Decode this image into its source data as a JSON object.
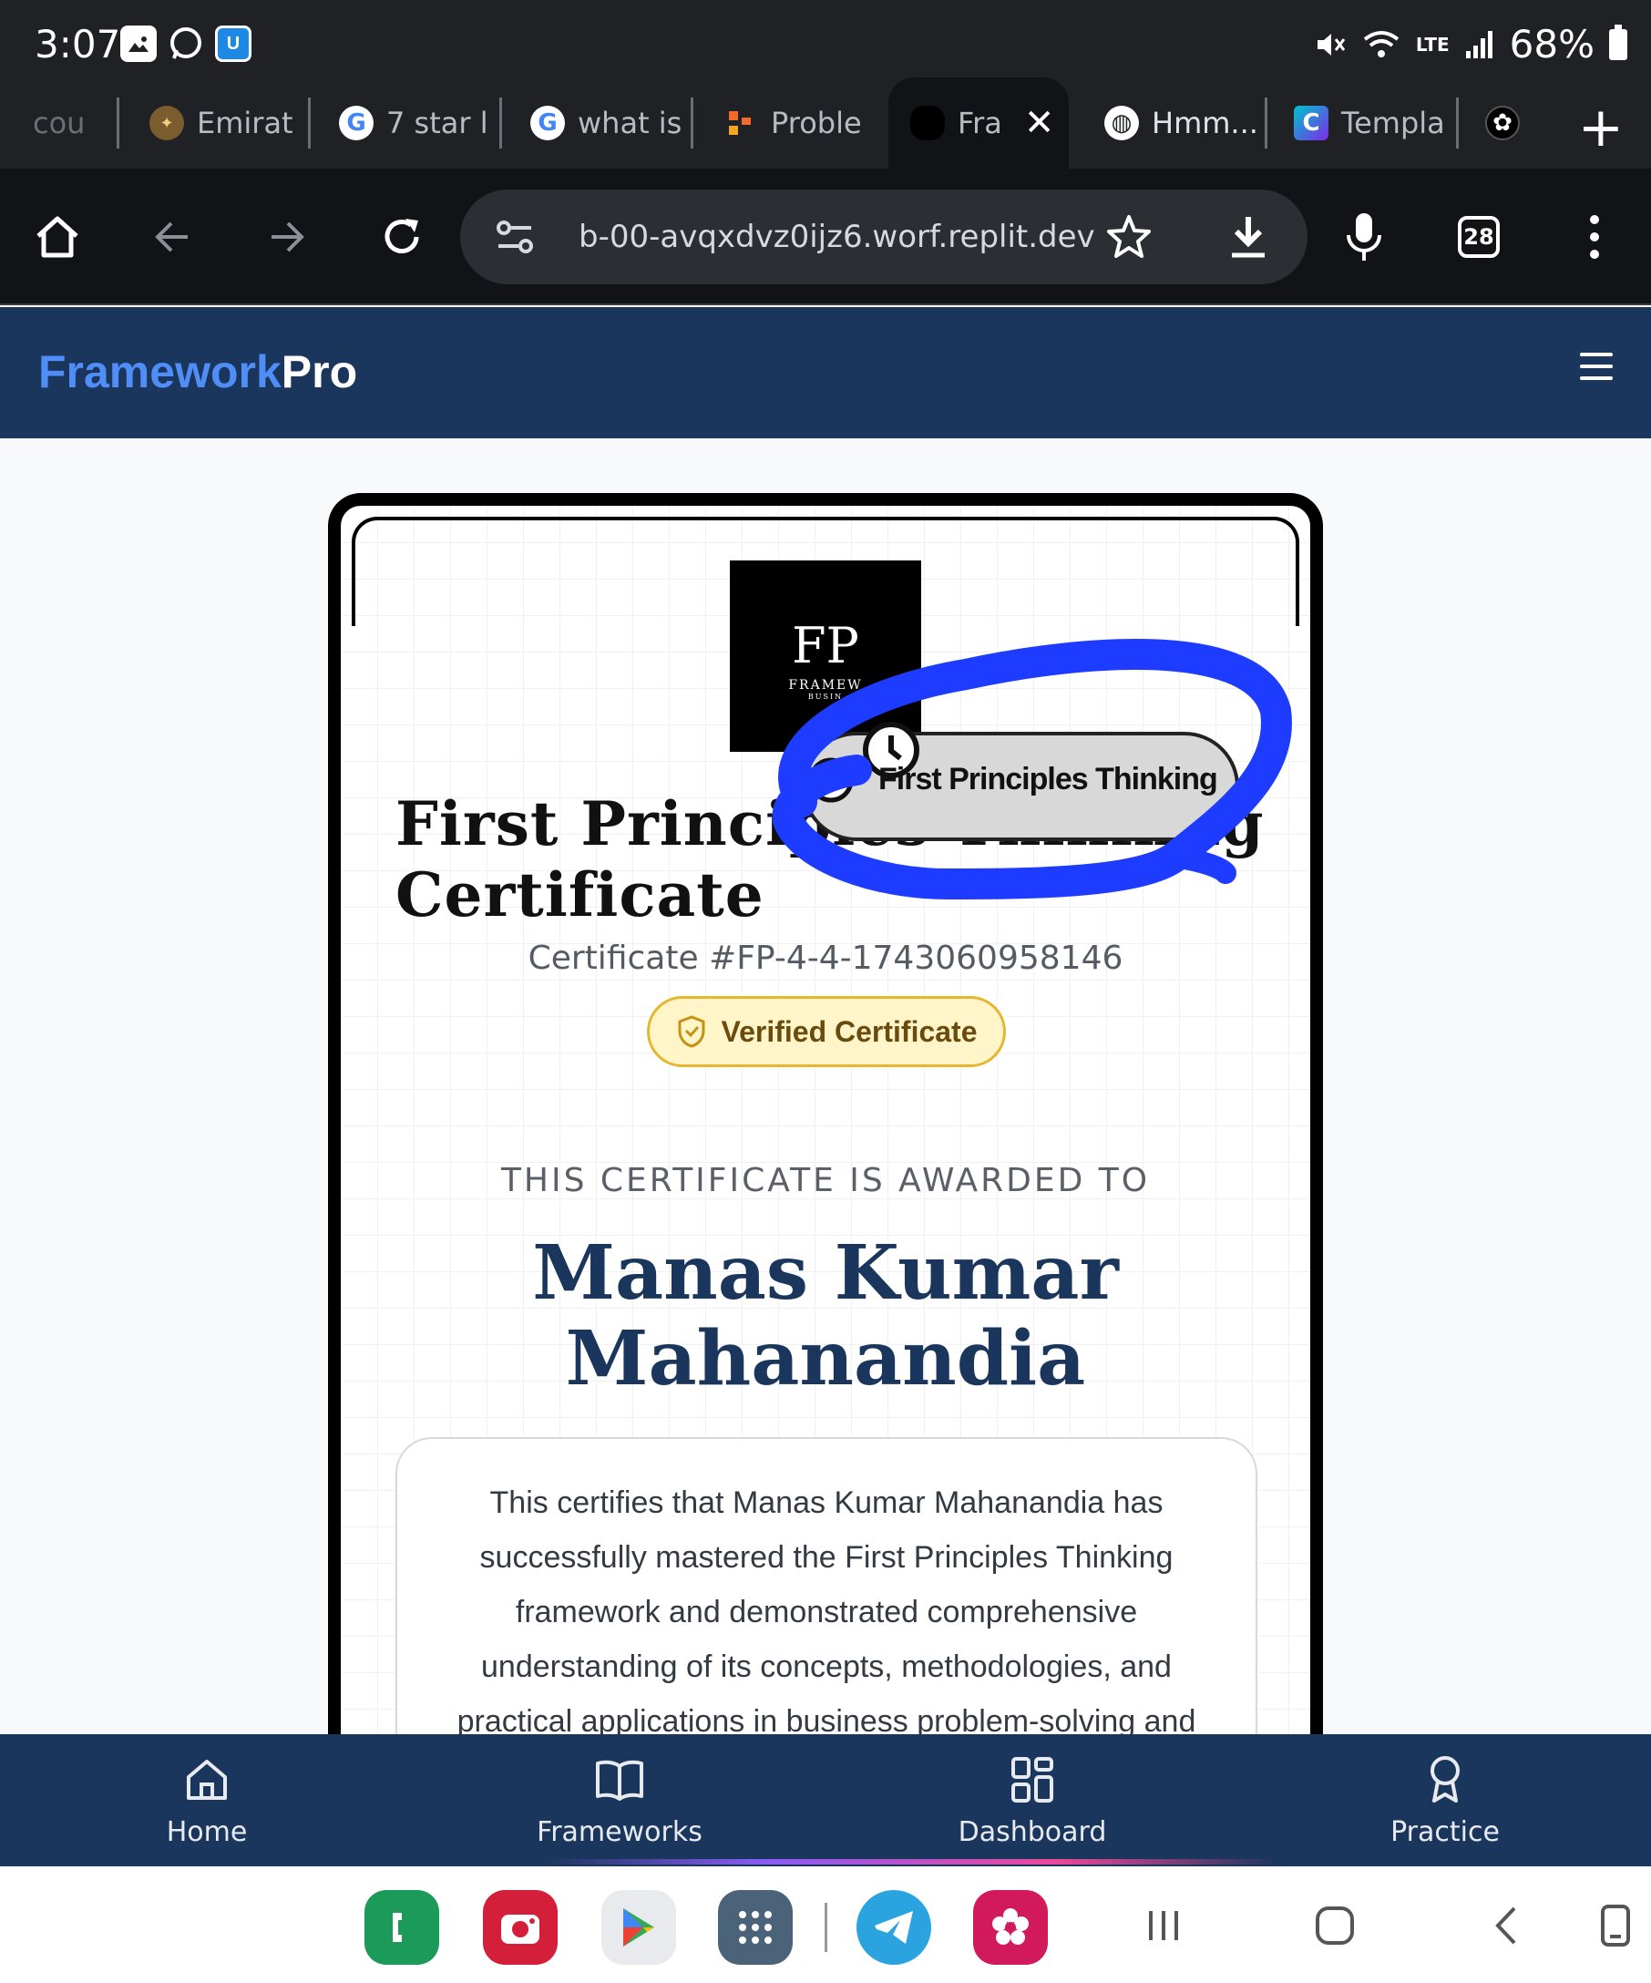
{
  "status_bar": {
    "time": "3:07",
    "battery": "68%",
    "network": "LTE"
  },
  "tabs": [
    {
      "label": "cou",
      "icon": "generic-icon"
    },
    {
      "label": "Emirat",
      "icon": "emblem-icon"
    },
    {
      "label": "7 star l",
      "icon": "google-icon"
    },
    {
      "label": "what is",
      "icon": "google-icon"
    },
    {
      "label": "Proble",
      "icon": "grid-icon"
    },
    {
      "label": "Fra",
      "icon": "brain-icon",
      "active": true
    },
    {
      "label": "Hmm...",
      "icon": "globe-icon"
    },
    {
      "label": "Templa",
      "icon": "canva-icon"
    },
    {
      "label": "",
      "icon": "openai-icon"
    }
  ],
  "browser": {
    "url": "b-00-avqxdvz0ijz6.worf.replit.dev",
    "tab_count": "28"
  },
  "site": {
    "brand_part1": "Framework",
    "brand_part2": "Pro"
  },
  "certificate": {
    "logo_monogram": "FP",
    "logo_text": "FRAMEW",
    "logo_subtext": "BUSIN",
    "title_line1": "First Principles Thinking",
    "title_line2": "Certificate",
    "number": "Certificate #FP-4-4-1743060958146",
    "verified_label": "Verified Certificate",
    "awarded_to": "THIS CERTIFICATE IS AWARDED TO",
    "recipient_line1": "Manas Kumar",
    "recipient_line2": "Mahanandia",
    "description": "This certifies that Manas Kumar Mahanandia has successfully mastered the First Principles Thinking framework and demonstrated comprehensive understanding of its concepts, methodologies, and practical applications in business problem-solving and"
  },
  "floating_chip": {
    "label": "First Principles Thinking",
    "annotation_color": "#1e3cff"
  },
  "bottom_nav": [
    {
      "label": "Home",
      "icon": "home-icon"
    },
    {
      "label": "Frameworks",
      "icon": "book-icon"
    },
    {
      "label": "Dashboard",
      "icon": "dashboard-icon"
    },
    {
      "label": "Practice",
      "icon": "award-icon"
    }
  ],
  "colors": {
    "brand_navy": "#1b365d",
    "brand_blue": "#4f8ef7",
    "verified_bg": "#fff5c9",
    "verified_border": "#e6b72e"
  }
}
